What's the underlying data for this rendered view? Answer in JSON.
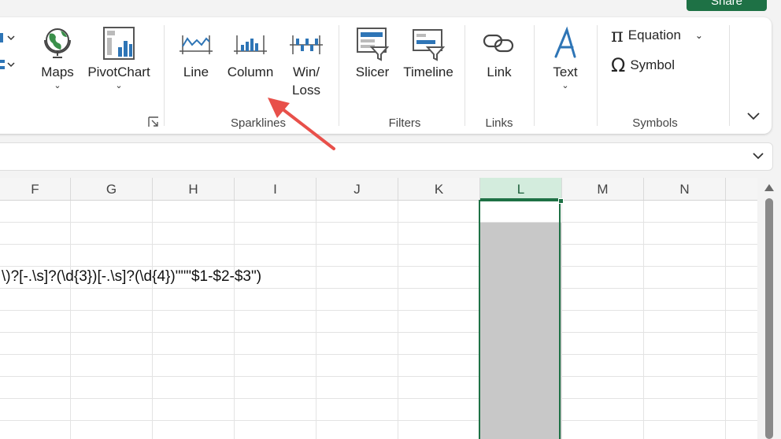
{
  "share": {
    "label": "Share"
  },
  "ribbon": {
    "charts": {
      "maps": "Maps",
      "pivotchart": "PivotChart"
    },
    "sparklines": {
      "group_label": "Sparklines",
      "line": "Line",
      "column": "Column",
      "winloss_line1": "Win/",
      "winloss_line2": "Loss"
    },
    "filters": {
      "group_label": "Filters",
      "slicer": "Slicer",
      "timeline": "Timeline"
    },
    "links": {
      "group_label": "Links",
      "link": "Link"
    },
    "text": {
      "text": "Text"
    },
    "symbols": {
      "group_label": "Symbols",
      "equation": "Equation",
      "symbol": "Symbol"
    }
  },
  "sheet": {
    "columns": [
      "F",
      "G",
      "H",
      "I",
      "J",
      "K",
      "L",
      "M",
      "N"
    ],
    "selected_column": "L",
    "visible_formula_text": "\\)?[-.\\s]?(\\d{3})[-.\\s]?(\\d{4})\"\"\"$1-$2-$3\")"
  },
  "colors": {
    "accent": "#1e7145",
    "arrow": "#e8504a",
    "sparkline_blue": "#2e75b6"
  }
}
